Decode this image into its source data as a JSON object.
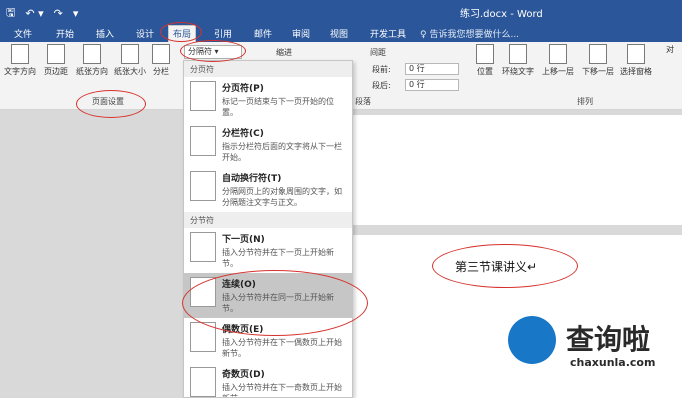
{
  "window": {
    "title": "练习.docx - Word"
  },
  "qat": {
    "save_icon": "save-icon",
    "undo_icon": "undo-icon",
    "redo_icon": "redo-icon"
  },
  "tabs": [
    {
      "label": "文件"
    },
    {
      "label": "开始"
    },
    {
      "label": "插入"
    },
    {
      "label": "设计"
    },
    {
      "label": "布局",
      "active": true
    },
    {
      "label": "引用"
    },
    {
      "label": "邮件"
    },
    {
      "label": "审阅"
    },
    {
      "label": "视图"
    },
    {
      "label": "开发工具"
    }
  ],
  "tellme": "♀ 告诉我您想要做什么...",
  "ribbon": {
    "page_setup": {
      "buttons": [
        "文字方向",
        "页边距",
        "纸张方向",
        "纸张大小",
        "分栏"
      ],
      "group_label": "页面设置"
    },
    "breaks_button": "分隔符 ▾",
    "indent_label": "缩进",
    "spacing": {
      "label": "间距",
      "before_label": "段前:",
      "before_value": "0 行",
      "after_label": "段后:",
      "after_value": "0 行"
    },
    "paragraph_group": "段落",
    "arrange": {
      "buttons": [
        "位置",
        "环绕文字",
        "上移一层",
        "下移一层",
        "选择窗格",
        "对"
      ],
      "group_label": "排列"
    }
  },
  "menu": {
    "section_page_breaks": "分页符",
    "section_section_breaks": "分节符",
    "items": [
      {
        "title": "分页符(P)",
        "desc": "标记一页结束与下一页开始的位置。"
      },
      {
        "title": "分栏符(C)",
        "desc": "指示分栏符后面的文字将从下一栏开始。"
      },
      {
        "title": "自动换行符(T)",
        "desc": "分隔网页上的对象周围的文字，如分隔题注文字与正文。"
      },
      {
        "title": "下一页(N)",
        "desc": "插入分节符并在下一页上开始新节。"
      },
      {
        "title": "连续(O)",
        "desc": "插入分节符并在同一页上开始新节。",
        "highlighted": true
      },
      {
        "title": "偶数页(E)",
        "desc": "插入分节符并在下一偶数页上开始新节。"
      },
      {
        "title": "奇数页(D)",
        "desc": "插入分节符并在下一奇数页上开始新节。"
      }
    ]
  },
  "document": {
    "heading": "第三节课讲义",
    "paragraph_mark": "↵"
  },
  "watermark": {
    "text": "查询啦",
    "url": "chaxunla.com"
  },
  "colors": {
    "accent": "#2b579a",
    "annotation": "#d6322d",
    "logo": "#1877c7"
  }
}
